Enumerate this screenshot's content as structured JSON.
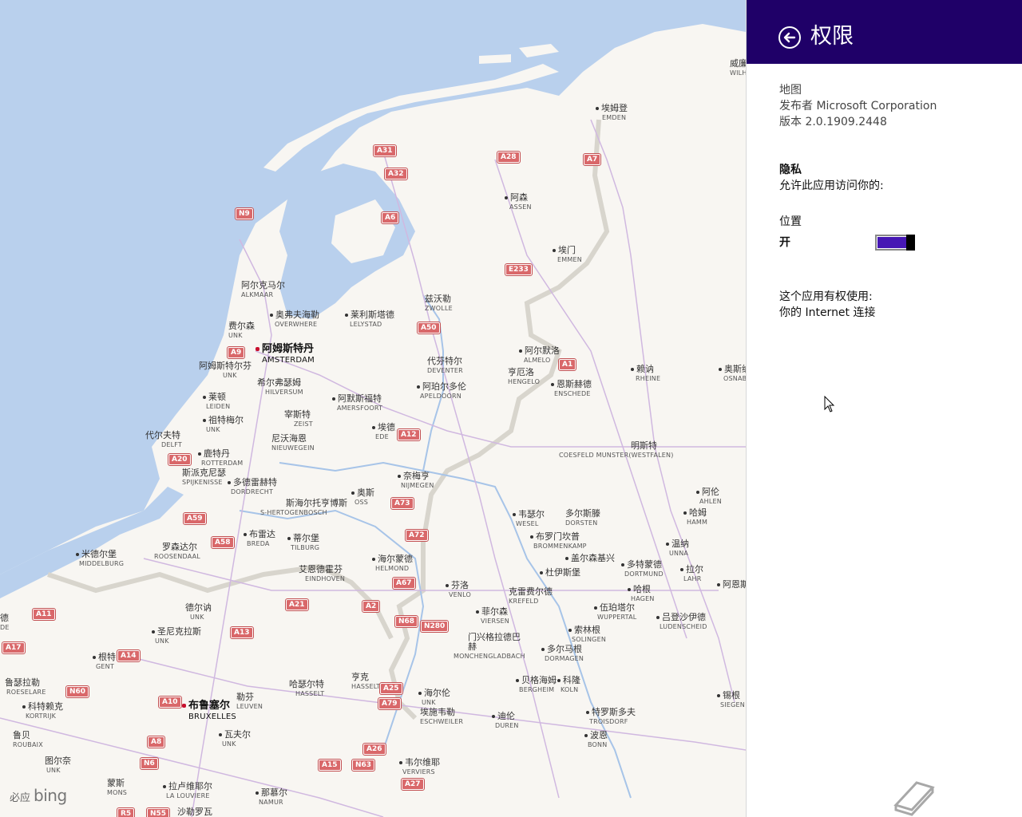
{
  "panel": {
    "title": "权限",
    "app_name": "地图",
    "publisher": "发布者 Microsoft Corporation",
    "version": "版本 2.0.1909.2448",
    "privacy_heading": "隐私",
    "privacy_desc": "允许此应用访问你的:",
    "location_label": "位置",
    "location_state": "开",
    "location_enabled": true,
    "capabilities_heading": "这个应用有权使用:",
    "capability_internet": "你的 Internet 连接",
    "header_color": "#1f0068",
    "toggle_color": "#4617b4"
  },
  "map": {
    "logo": "必应",
    "logo_brand": "bing",
    "places": [
      {
        "zh": "埃姆登",
        "en": "EMDEN"
      },
      {
        "zh": "阿森",
        "en": "ASSEN"
      },
      {
        "zh": "埃门",
        "en": "EMMEN"
      },
      {
        "zh": "兹沃勒",
        "en": "ZWOLLE"
      },
      {
        "zh": "阿尔克马尔",
        "en": "ALKMAAR"
      },
      {
        "zh": "奥弗夫海勒",
        "en": "OVERWHERE"
      },
      {
        "zh": "莱利斯塔德",
        "en": "LELYSTAD"
      },
      {
        "zh": "费尔森",
        "en": "UNK"
      },
      {
        "zh": "阿姆斯特丹",
        "en": "AMSTERDAM"
      },
      {
        "zh": "阿姆斯特尔芬",
        "en": "UNK"
      },
      {
        "zh": "希尔弗瑟姆",
        "en": "HILVERSUM"
      },
      {
        "zh": "阿默斯福特",
        "en": "AMERSFOORT"
      },
      {
        "zh": "代芬特尔",
        "en": "DEVENTER"
      },
      {
        "zh": "阿尔默洛",
        "en": "ALMELO"
      },
      {
        "zh": "亨厄洛",
        "en": "HENGELO"
      },
      {
        "zh": "恩斯赫德",
        "en": "ENSCHEDE"
      },
      {
        "zh": "阿珀尔多伦",
        "en": "APELDOORN"
      },
      {
        "zh": "赖讷",
        "en": "RHEINE"
      },
      {
        "zh": "奥斯纳",
        "en": "OSNAB"
      },
      {
        "zh": "莱顿",
        "en": "LEIDEN"
      },
      {
        "zh": "祖特梅尔",
        "en": "UNK"
      },
      {
        "zh": "宰斯特",
        "en": "ZEIST"
      },
      {
        "zh": "埃德",
        "en": "EDE"
      },
      {
        "zh": "代尔夫特",
        "en": "DELFT"
      },
      {
        "zh": "鹿特丹",
        "en": "ROTTERDAM"
      },
      {
        "zh": "尼沃海恩",
        "en": "NIEUWEGEIN"
      },
      {
        "zh": "明斯特",
        "en": "COESFELD MUNSTER(WESTFALEN)"
      },
      {
        "zh": "斯派克尼瑟",
        "en": "SPIJKENISSE"
      },
      {
        "zh": "多德雷赫特",
        "en": "DORDRECHT"
      },
      {
        "zh": "奈梅亨",
        "en": "NIJMEGEN"
      },
      {
        "zh": "奥斯",
        "en": "OSS"
      },
      {
        "zh": "斯海尔托亨博斯",
        "en": "S-HERTOGENBOSCH"
      },
      {
        "zh": "韦瑟尔",
        "en": "WESEL"
      },
      {
        "zh": "多尔斯滕",
        "en": "DORSTEN"
      },
      {
        "zh": "阿伦",
        "en": "AHLEN"
      },
      {
        "zh": "哈姆",
        "en": "HAMM"
      },
      {
        "zh": "布雷达",
        "en": "BREDA"
      },
      {
        "zh": "蒂尔堡",
        "en": "TILBURG"
      },
      {
        "zh": "罗森达尔",
        "en": "ROOSENDAAL"
      },
      {
        "zh": "米德尔堡",
        "en": "MIDDELBURG"
      },
      {
        "zh": "布罗门坎普",
        "en": "BROMMENKAMP"
      },
      {
        "zh": "盖尔森基兴",
        "en": ""
      },
      {
        "zh": "温纳",
        "en": "UNNA"
      },
      {
        "zh": "多特蒙德",
        "en": "DORTMUND"
      },
      {
        "zh": "拉尔",
        "en": "LAHR"
      },
      {
        "zh": "杜伊斯堡",
        "en": ""
      },
      {
        "zh": "艾恩德霍芬",
        "en": "EINDHOVEN"
      },
      {
        "zh": "海尔蒙德",
        "en": "HELMOND"
      },
      {
        "zh": "芬洛",
        "en": "VENLO"
      },
      {
        "zh": "克雷费尔德",
        "en": "KREFELD"
      },
      {
        "zh": "哈根",
        "en": "HAGEN"
      },
      {
        "zh": "阿恩斯",
        "en": ""
      },
      {
        "zh": "德尔讷",
        "en": "UNK"
      },
      {
        "zh": "伍珀塔尔",
        "en": "WUPPERTAL"
      },
      {
        "zh": "吕登沙伊德",
        "en": "LUDENSCHEID"
      },
      {
        "zh": "菲尔森",
        "en": "VIERSEN"
      },
      {
        "zh": "圣尼克拉斯",
        "en": "UNK"
      },
      {
        "zh": "索林根",
        "en": "SOLINGEN"
      },
      {
        "zh": "门兴格拉德巴赫",
        "en": "MONCHENGLADBACH"
      },
      {
        "zh": "多尔马根",
        "en": "DORMAGEN"
      },
      {
        "zh": "根特",
        "en": "GENT"
      },
      {
        "zh": "鲁瑟拉勒",
        "en": "ROESELARE"
      },
      {
        "zh": "亨克",
        "en": "HASSELT"
      },
      {
        "zh": "哈瑟尔特",
        "en": "HASSELT"
      },
      {
        "zh": "海尔伦",
        "en": "UNK"
      },
      {
        "zh": "贝格海姆",
        "en": "BERGHEIM"
      },
      {
        "zh": "科隆",
        "en": "KOLN"
      },
      {
        "zh": "锡根",
        "en": "SIEGEN"
      },
      {
        "zh": "科特赖克",
        "en": "KORTRIJK"
      },
      {
        "zh": "布鲁塞尔",
        "en": "BRUXELLES"
      },
      {
        "zh": "勒芬",
        "en": "LEUVEN"
      },
      {
        "zh": "埃施韦勒",
        "en": "ESCHWEILER"
      },
      {
        "zh": "迪伦",
        "en": "DUREN"
      },
      {
        "zh": "特罗斯多夫",
        "en": "TROISDORF"
      },
      {
        "zh": "鲁贝",
        "en": "ROUBAIX"
      },
      {
        "zh": "瓦夫尔",
        "en": "UNK"
      },
      {
        "zh": "波恩",
        "en": "BONN"
      },
      {
        "zh": "图尔奈",
        "en": "UNK"
      },
      {
        "zh": "韦尔维耶",
        "en": "VERVIERS"
      },
      {
        "zh": "蒙斯",
        "en": "MONS"
      },
      {
        "zh": "拉卢维耶尔",
        "en": "LA LOUVIERE"
      },
      {
        "zh": "那慕尔",
        "en": "NAMUR"
      },
      {
        "zh": "沙勒罗瓦",
        "en": ""
      },
      {
        "zh": "威廉",
        "en": "WILH"
      },
      {
        "zh": "德",
        "en": "DE"
      }
    ],
    "shields": [
      "A31",
      "A32",
      "A28",
      "A7",
      "N9",
      "A6",
      "E233",
      "A50",
      "A9",
      "A1",
      "A12",
      "A20",
      "A73",
      "A59",
      "A72",
      "A58",
      "A67",
      "A21",
      "A2",
      "A11",
      "N68",
      "N280",
      "A13",
      "A17",
      "A14",
      "N60",
      "A25",
      "A10",
      "A79",
      "A8",
      "A26",
      "N6",
      "A15",
      "N63",
      "A27",
      "R5",
      "N55"
    ]
  }
}
